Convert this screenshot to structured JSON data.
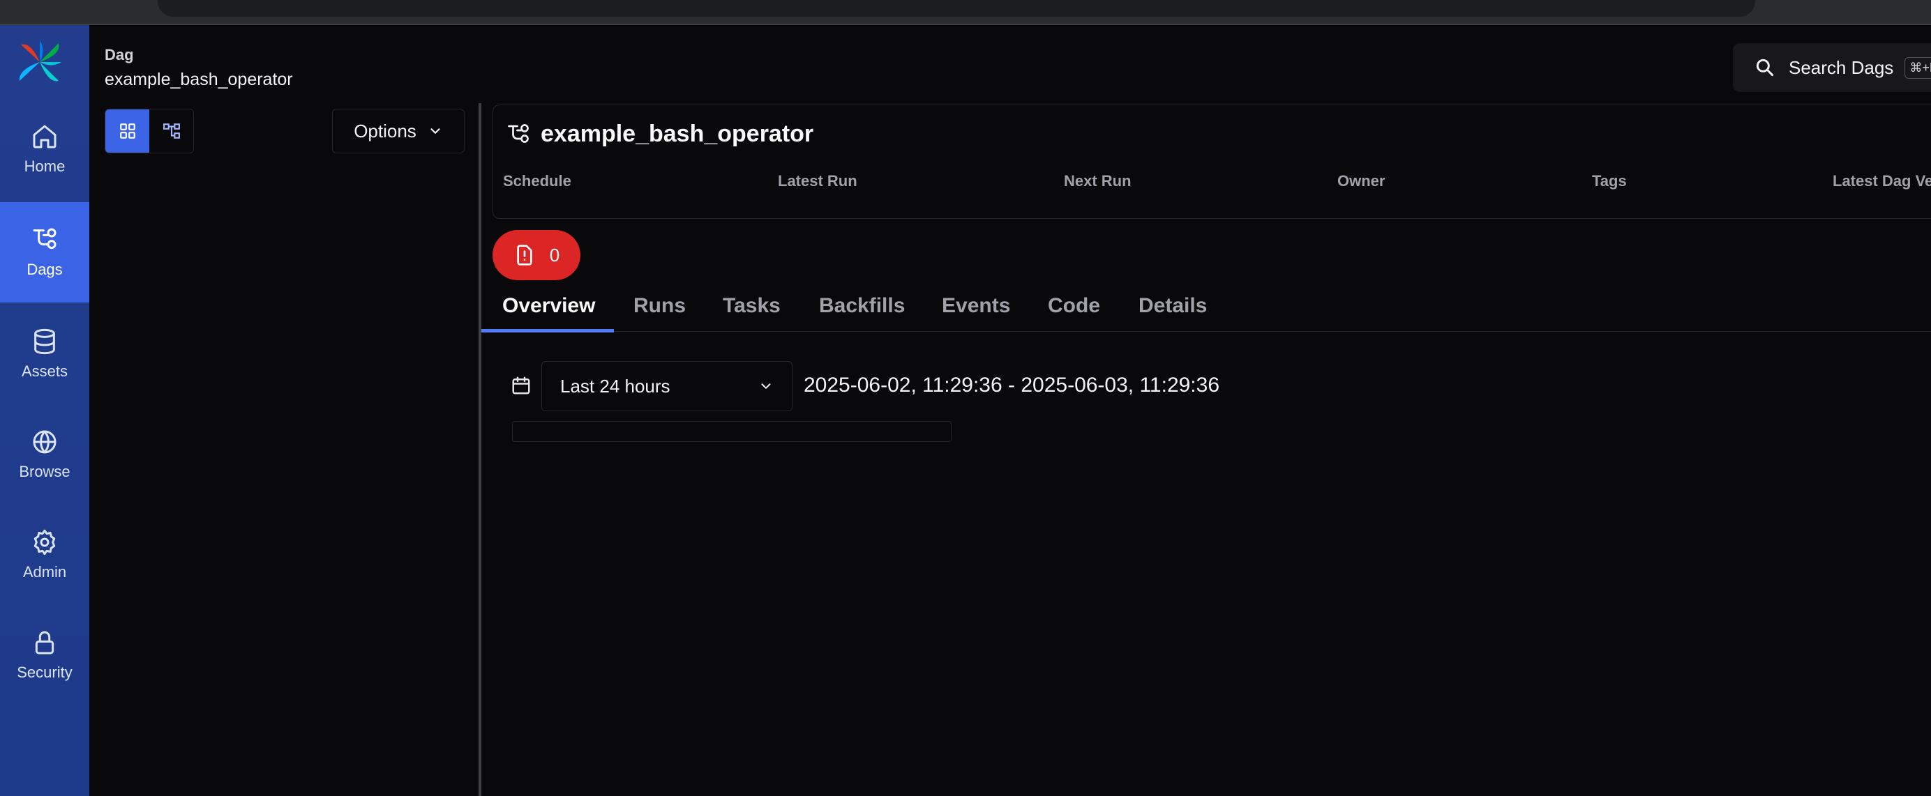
{
  "sidebar": {
    "items": [
      {
        "label": "Home",
        "icon": "home-icon"
      },
      {
        "label": "Dags",
        "icon": "dag-icon",
        "active": true
      },
      {
        "label": "Assets",
        "icon": "database-icon"
      },
      {
        "label": "Browse",
        "icon": "globe-icon"
      },
      {
        "label": "Admin",
        "icon": "gear-icon"
      },
      {
        "label": "Security",
        "icon": "lock-icon"
      }
    ]
  },
  "breadcrumb": {
    "section": "Dag",
    "current": "example_bash_operator"
  },
  "search": {
    "label": "Search Dags",
    "shortcut": "⌘+K"
  },
  "options": {
    "label": "Options"
  },
  "dag_header": {
    "title": "example_bash_operator",
    "meta_labels": [
      "Schedule",
      "Latest Run",
      "Next Run",
      "Owner",
      "Tags",
      "Latest Dag Version"
    ]
  },
  "warning_badge": {
    "count": "0"
  },
  "tabs": [
    "Overview",
    "Runs",
    "Tasks",
    "Backfills",
    "Events",
    "Code",
    "Details"
  ],
  "overview": {
    "time_range": "Last 24 hours",
    "range_text": "2025-06-02, 11:29:36 - 2025-06-03, 11:29:36"
  },
  "colors": {
    "sidebar": "#1e3a8a",
    "active_nav": "#3b63e6",
    "warning": "#dc2626",
    "background": "#09090b"
  }
}
